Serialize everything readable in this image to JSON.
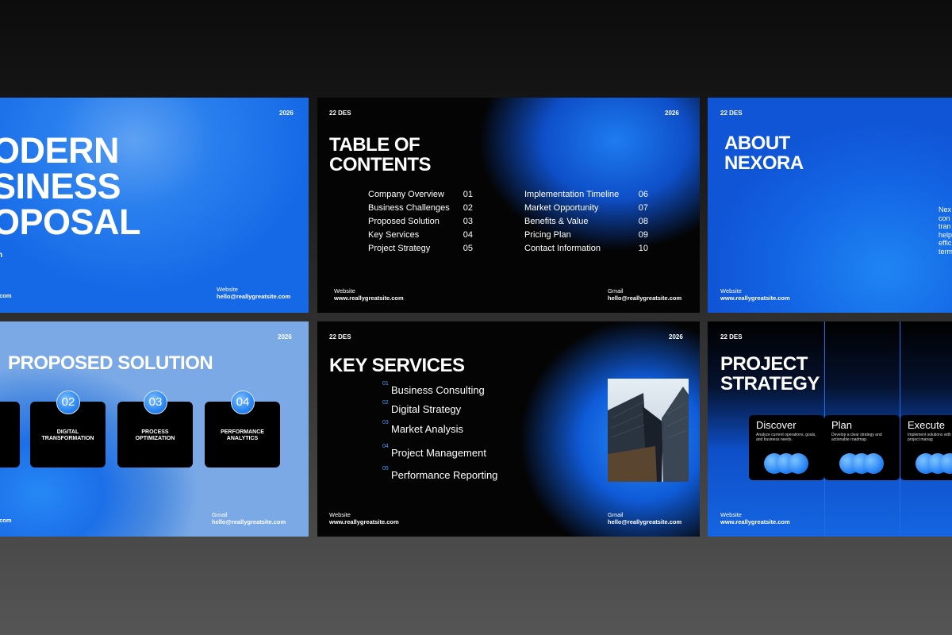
{
  "common": {
    "year": "2026",
    "date": "22 DES",
    "website_label": "Website",
    "website_url": "www.reallygreatsite.com",
    "gmail_label": "Gmail",
    "gmail_address": "hello@reallygreatsite.com",
    "com_fragment": ".com",
    "n_fragment": "n"
  },
  "slide1": {
    "title_lines": [
      "ODERN",
      "SINESS",
      "OPOSAL"
    ]
  },
  "slide2": {
    "title_lines": [
      "TABLE OF",
      "CONTENTS"
    ],
    "left_items": [
      {
        "label": "Company Overview",
        "num": "01"
      },
      {
        "label": "Business Challenges",
        "num": "02"
      },
      {
        "label": "Proposed Solution",
        "num": "03"
      },
      {
        "label": "Key Services",
        "num": "04"
      },
      {
        "label": "Project Strategy",
        "num": "05"
      }
    ],
    "right_items": [
      {
        "label": "Implementation Timeline",
        "num": "06"
      },
      {
        "label": "Market Opportunity",
        "num": "07"
      },
      {
        "label": "Benefits & Value",
        "num": "08"
      },
      {
        "label": "Pricing Plan",
        "num": "09"
      },
      {
        "label": "Contact Information",
        "num": "10"
      }
    ]
  },
  "slide3": {
    "title_lines": [
      "ABOUT",
      "NEXORA"
    ],
    "side_text": [
      "Nex",
      "con",
      "tran",
      "help",
      "effic",
      "term"
    ]
  },
  "slide4": {
    "title": "PROPOSED SOLUTION",
    "boxes": [
      {
        "num": "02",
        "label_lines": [
          "DIGITAL",
          "TRANSFORMATION"
        ]
      },
      {
        "num": "03",
        "label_lines": [
          "PROCESS",
          "OPTIMIZATION"
        ]
      },
      {
        "num": "04",
        "label_lines": [
          "PERFORMANCE",
          "ANALYTICS"
        ]
      }
    ]
  },
  "slide5": {
    "title": "KEY SERVICES",
    "services": [
      {
        "num": "01",
        "label": "Business Consulting"
      },
      {
        "num": "02",
        "label": "Digital Strategy"
      },
      {
        "num": "03",
        "label": "Market Analysis"
      },
      {
        "num": "04",
        "label": "Project Management"
      },
      {
        "num": "05",
        "label": "Performance Reporting"
      }
    ]
  },
  "slide6": {
    "title_lines": [
      "PROJECT",
      "STRATEGY"
    ],
    "cards": [
      {
        "title": "Discover",
        "desc": "Analyze current operations, goals, and business needs."
      },
      {
        "title": "Plan",
        "desc": "Develop a clear strategy and actionable roadmap."
      },
      {
        "title": "Execute",
        "desc": "Implement solutions with efficient project manag"
      }
    ]
  }
}
